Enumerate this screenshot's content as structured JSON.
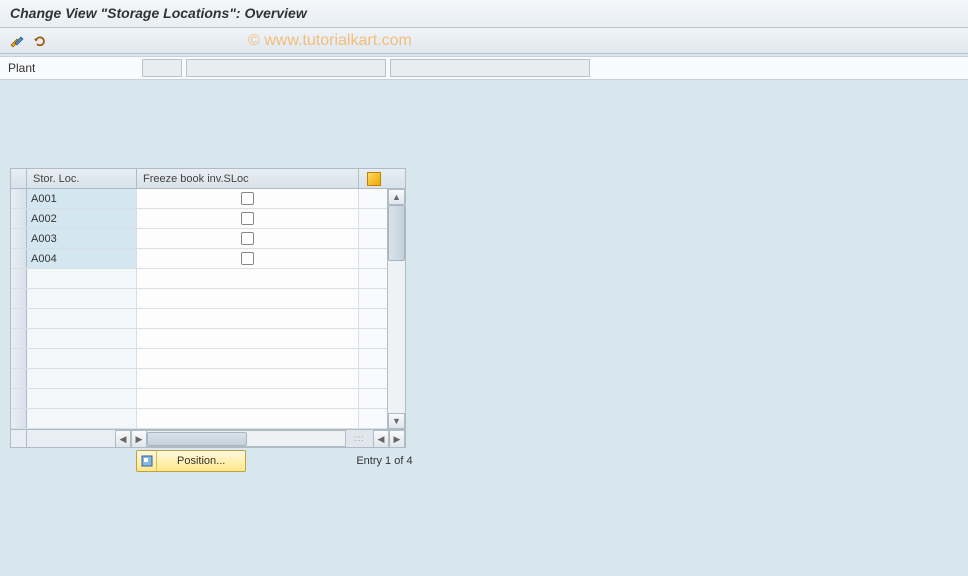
{
  "header": {
    "title": "Change View \"Storage Locations\": Overview"
  },
  "watermark": "© www.tutorialkart.com",
  "form": {
    "plant_label": "Plant",
    "plant_code": "",
    "plant_name": "",
    "plant_desc": ""
  },
  "table": {
    "columns": {
      "stor_loc": "Stor. Loc.",
      "freeze": "Freeze book inv.SLoc"
    },
    "rows": [
      {
        "stor_loc": "A001",
        "freeze": false
      },
      {
        "stor_loc": "A002",
        "freeze": false
      },
      {
        "stor_loc": "A003",
        "freeze": false
      },
      {
        "stor_loc": "A004",
        "freeze": false
      }
    ]
  },
  "footer": {
    "position_label": "Position...",
    "entry_status": "Entry 1 of 4"
  },
  "icons": {
    "pencils": "pencils-icon",
    "undo": "undo-icon",
    "config": "table-settings-icon",
    "position": "position-icon"
  }
}
